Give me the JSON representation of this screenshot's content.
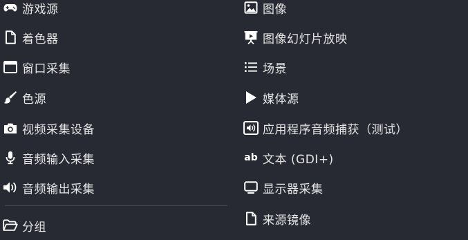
{
  "menu": {
    "left": [
      {
        "label": "游戏源",
        "icon": "gamepad-icon"
      },
      {
        "label": "着色器",
        "icon": "file-icon"
      },
      {
        "label": "窗口采集",
        "icon": "window-icon"
      },
      {
        "label": "色源",
        "icon": "brush-icon"
      },
      {
        "label": "视频采集设备",
        "icon": "camera-icon"
      },
      {
        "label": "音频输入采集",
        "icon": "microphone-icon"
      },
      {
        "label": "音频输出采集",
        "icon": "speaker-icon"
      },
      {
        "label": "分组",
        "icon": "folder-icon"
      }
    ],
    "right": [
      {
        "label": "图像",
        "icon": "image-icon"
      },
      {
        "label": "图像幻灯片放映",
        "icon": "slideshow-icon"
      },
      {
        "label": "场景",
        "icon": "list-icon"
      },
      {
        "label": "媒体源",
        "icon": "play-icon"
      },
      {
        "label": "应用程序音频捕获（测试）",
        "icon": "app-audio-icon"
      },
      {
        "label": "文本 (GDI+)",
        "icon": "text-icon",
        "icon_text": "ab"
      },
      {
        "label": "显示器采集",
        "icon": "monitor-icon"
      },
      {
        "label": "来源镜像",
        "icon": "file-icon"
      }
    ]
  },
  "colors": {
    "background": "#272a33",
    "text": "#e6e6e6",
    "separator": "#474b57"
  }
}
